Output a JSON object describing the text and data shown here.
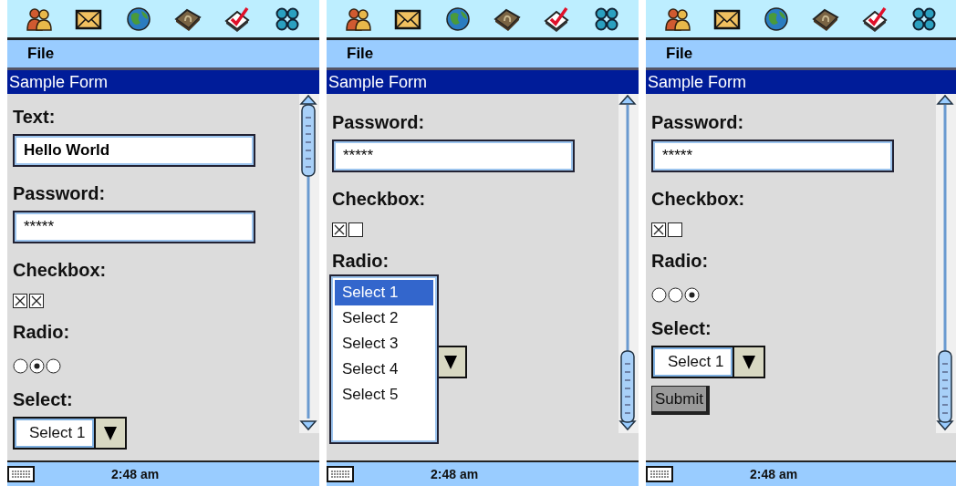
{
  "panels": [
    {
      "menu": [
        "File"
      ],
      "title": "Sample Form",
      "fields": [
        {
          "kind": "text",
          "label": "Text:",
          "value": "Hello World"
        },
        {
          "kind": "password",
          "label": "Password:",
          "value": "*****"
        },
        {
          "kind": "checkbox",
          "label": "Checkbox:",
          "options": [
            {
              "checked": true
            },
            {
              "checked": true
            }
          ]
        },
        {
          "kind": "radio",
          "label": "Radio:",
          "options": [
            {
              "selected": false
            },
            {
              "selected": true
            },
            {
              "selected": false
            }
          ]
        },
        {
          "kind": "select",
          "label": "Select:",
          "value": "Select 1"
        }
      ],
      "clock": "2:48 am"
    },
    {
      "menu": [
        "File"
      ],
      "title": "Sample Form",
      "fields": [
        {
          "kind": "password",
          "label": "Password:",
          "value": "*****"
        },
        {
          "kind": "checkbox",
          "label": "Checkbox:",
          "options": [
            {
              "checked": true
            },
            {
              "checked": false
            }
          ]
        },
        {
          "kind": "radio",
          "label": "Radio:"
        },
        {
          "kind": "select",
          "open": true,
          "options": [
            {
              "label": "Select 1",
              "selected": true
            },
            {
              "label": "Select 2",
              "selected": false
            },
            {
              "label": "Select 3",
              "selected": false
            },
            {
              "label": "Select 4",
              "selected": false
            },
            {
              "label": "Select 5",
              "selected": false
            }
          ]
        }
      ],
      "clock": "2:48 am"
    },
    {
      "menu": [
        "File"
      ],
      "title": "Sample Form",
      "fields": [
        {
          "kind": "password",
          "label": "Password:",
          "value": "*****"
        },
        {
          "kind": "checkbox",
          "label": "Checkbox:",
          "options": [
            {
              "checked": true
            },
            {
              "checked": false
            }
          ]
        },
        {
          "kind": "radio",
          "label": "Radio:",
          "options": [
            {
              "selected": false
            },
            {
              "selected": false
            },
            {
              "selected": true
            }
          ]
        },
        {
          "kind": "select",
          "label": "Select:",
          "value": "Select 1"
        },
        {
          "kind": "submit",
          "label": "Submit"
        }
      ],
      "clock": "2:48 am"
    }
  ]
}
